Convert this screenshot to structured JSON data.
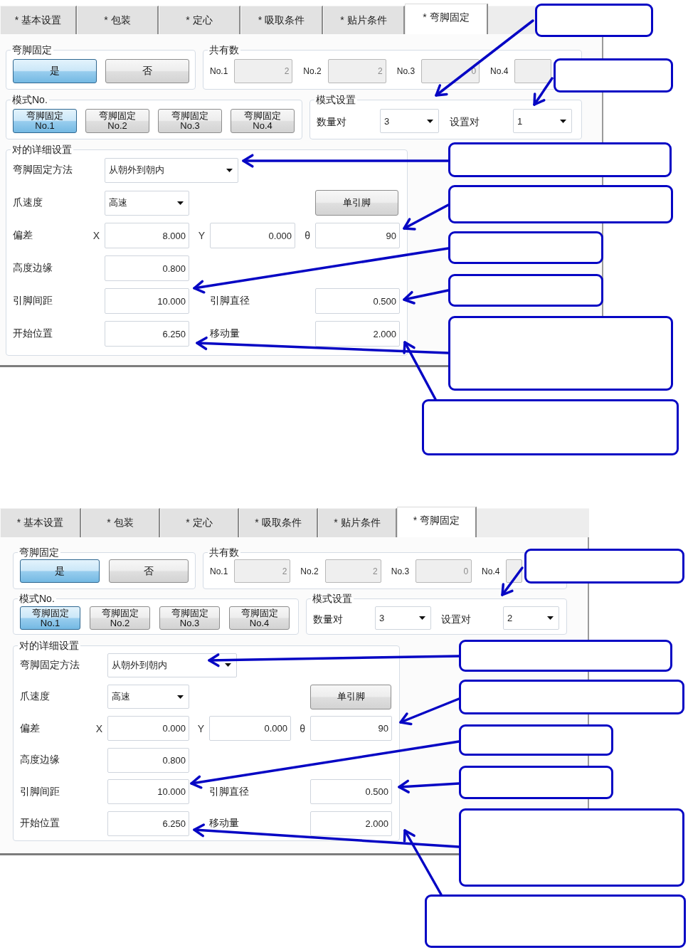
{
  "panels": [
    {
      "tabs": [
        {
          "label": "* 基本设置",
          "selected": false
        },
        {
          "label": "* 包装",
          "selected": false
        },
        {
          "label": "* 定心",
          "selected": false
        },
        {
          "label": "* 吸取条件",
          "selected": false
        },
        {
          "label": "* 贴片条件",
          "selected": false
        },
        {
          "label": "* 弯脚固定",
          "selected": true
        }
      ],
      "bend_fix": {
        "title": "弯脚固定",
        "options": [
          {
            "label": "是",
            "selected": true
          },
          {
            "label": "否",
            "selected": false
          }
        ]
      },
      "shared_count": {
        "title": "共有数",
        "items": [
          {
            "label": "No.1",
            "value": "2",
            "disabled": true
          },
          {
            "label": "No.2",
            "value": "2",
            "disabled": true
          },
          {
            "label": "No.3",
            "value": "0",
            "disabled": true
          },
          {
            "label": "No.4",
            "disabled": true
          }
        ]
      },
      "pattern_no": {
        "title": "模式No.",
        "options": [
          {
            "label": "弯脚固定",
            "number": "No.1",
            "selected": true
          },
          {
            "label": "弯脚固定",
            "number": "No.2",
            "selected": false
          },
          {
            "label": "弯脚固定",
            "number": "No.3",
            "selected": false
          },
          {
            "label": "弯脚固定",
            "number": "No.4",
            "selected": false
          }
        ]
      },
      "pattern_settings": {
        "title": "模式设置",
        "fields": [
          {
            "label": "数量对",
            "value": "3"
          },
          {
            "label": "设置对",
            "value": "1"
          }
        ]
      },
      "detail": {
        "title": "对的详细设置",
        "rows": [
          {
            "kind": "dropdown",
            "label": "弯脚固定方法",
            "value": "从朝外到朝内"
          },
          {
            "kind": "dropdown_button",
            "label": "爪速度",
            "value": "高速",
            "button": "单引脚"
          },
          {
            "kind": "xyz",
            "label": "偏差",
            "fields": [
              {
                "axis": "X",
                "value": "8.000"
              },
              {
                "axis": "Y",
                "value": "0.000"
              },
              {
                "axis": "θ",
                "value": "90"
              }
            ]
          },
          {
            "kind": "field",
            "label": "高度边缘",
            "value": "0.800"
          },
          {
            "kind": "field_pair",
            "label": "引脚间距",
            "value": "10.000",
            "label_2": "引脚直径",
            "value_2": "0.500"
          },
          {
            "kind": "field_pair",
            "label": "开始位置",
            "value": "6.250",
            "label_2": "移动量",
            "value_2": "2.000"
          }
        ]
      }
    },
    {
      "tabs": [
        {
          "label": "* 基本设置",
          "selected": false
        },
        {
          "label": "* 包装",
          "selected": false
        },
        {
          "label": "* 定心",
          "selected": false
        },
        {
          "label": "* 吸取条件",
          "selected": false
        },
        {
          "label": "* 贴片条件",
          "selected": false
        },
        {
          "label": "* 弯脚固定",
          "selected": true
        }
      ],
      "bend_fix": {
        "title": "弯脚固定",
        "options": [
          {
            "label": "是",
            "selected": true
          },
          {
            "label": "否",
            "selected": false
          }
        ]
      },
      "shared_count": {
        "title": "共有数",
        "items": [
          {
            "label": "No.1",
            "value": "2",
            "disabled": true
          },
          {
            "label": "No.2",
            "value": "2",
            "disabled": true
          },
          {
            "label": "No.3",
            "value": "0",
            "disabled": true
          },
          {
            "label": "No.4",
            "disabled": true
          }
        ]
      },
      "pattern_no": {
        "title": "模式No.",
        "options": [
          {
            "label": "弯脚固定",
            "number": "No.1",
            "selected": true
          },
          {
            "label": "弯脚固定",
            "number": "No.2",
            "selected": false
          },
          {
            "label": "弯脚固定",
            "number": "No.3",
            "selected": false
          },
          {
            "label": "弯脚固定",
            "number": "No.4",
            "selected": false
          }
        ]
      },
      "pattern_settings": {
        "title": "模式设置",
        "fields": [
          {
            "label": "数量对",
            "value": "3"
          },
          {
            "label": "设置对",
            "value": "2"
          }
        ]
      },
      "detail": {
        "title": "对的详细设置",
        "rows": [
          {
            "kind": "dropdown",
            "label": "弯脚固定方法",
            "value": "从朝外到朝内"
          },
          {
            "kind": "dropdown_button",
            "label": "爪速度",
            "value": "高速",
            "button": "单引脚"
          },
          {
            "kind": "xyz",
            "label": "偏差",
            "fields": [
              {
                "axis": "X",
                "value": "0.000"
              },
              {
                "axis": "Y",
                "value": "0.000"
              },
              {
                "axis": "θ",
                "value": "90"
              }
            ]
          },
          {
            "kind": "field",
            "label": "高度边缘",
            "value": "0.800"
          },
          {
            "kind": "field_pair",
            "label": "引脚间距",
            "value": "10.000",
            "label_2": "引脚直径",
            "value_2": "0.500"
          },
          {
            "kind": "field_pair",
            "label": "开始位置",
            "value": "6.250",
            "label_2": "移动量",
            "value_2": "2.000"
          }
        ]
      }
    }
  ]
}
